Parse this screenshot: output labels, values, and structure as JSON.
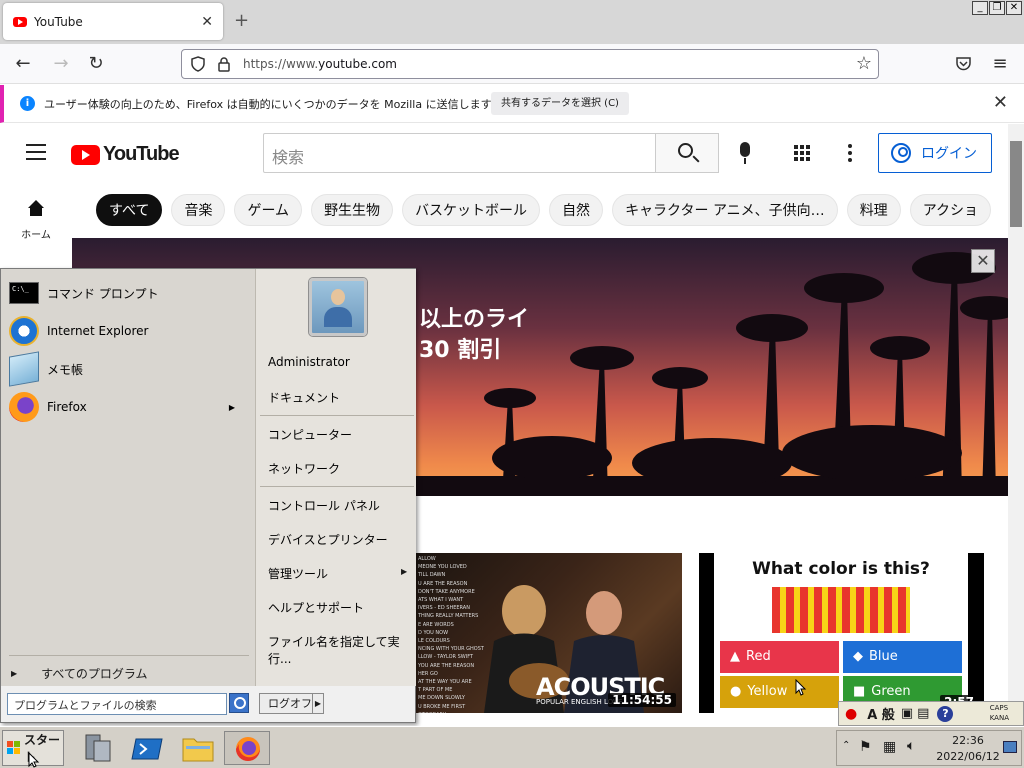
{
  "browser": {
    "tab_title": "YouTube",
    "new_tab": "+",
    "url_prefix": "https://www.",
    "url_domain": "youtube.com",
    "window_min": "_",
    "window_restore": "❐",
    "window_close": "✕"
  },
  "notification": {
    "message": "ユーザー体験の向上のため、Firefox は自動的にいくつかのデータを Mozilla に送信します。",
    "button": "共有するデータを選択 (C)"
  },
  "youtube": {
    "logo_text": "YouTube",
    "search_placeholder": "検索",
    "login_label": "ログイン",
    "home_label": "ホーム",
    "chips": [
      "すべて",
      "音楽",
      "ゲーム",
      "野生生物",
      "バスケットボール",
      "自然",
      "キャラクター アニメ、子供向…",
      "料理",
      "アクショ"
    ],
    "banner_line1": "以上のライ",
    "banner_line2": "30 割引",
    "video1": {
      "title": "ACOUSTIC",
      "subtitle": "POPULAR ENGLISH LOVE",
      "duration": "11:54:55",
      "songs": [
        "ALLOW",
        "MEONE YOU LOVED",
        "TILL DAWN",
        "U ARE THE REASON",
        "DON'T TAKE ANYMORE",
        "ATS WHAT I WANT",
        "IVERS - ED SHEERAN",
        "THING REALLY MATTERS",
        "E ARE WORDS",
        "D YOU NOW",
        "LE COLOURS",
        "NCING WITH YOUR GHOST",
        "LLOW - TAYLOR SWIFT",
        "YOU ARE THE REASON",
        "HER GO",
        "AT THE WAY YOU ARE",
        "T PART OF ME",
        "ME DOWN SLOWLY",
        "U BROKE ME FIRST",
        "OTOGRAPH"
      ]
    },
    "video2": {
      "question": "What color is this?",
      "options": [
        {
          "label": "Red",
          "color": "#e8354a",
          "symbol": "▲"
        },
        {
          "label": "Blue",
          "color": "#1e6fd6",
          "symbol": "◆"
        },
        {
          "label": "Yellow",
          "color": "#d6a20b",
          "symbol": "●"
        },
        {
          "label": "Green",
          "color": "#2f9a32",
          "symbol": "■"
        }
      ],
      "duration": "2:57"
    }
  },
  "start_menu": {
    "left_items": [
      {
        "label": "コマンド プロンプト",
        "icon": "cmd-icon"
      },
      {
        "label": "Internet Explorer",
        "icon": "ie-icon"
      },
      {
        "label": "メモ帳",
        "icon": "notepad-icon"
      },
      {
        "label": "Firefox",
        "icon": "firefox-icon"
      }
    ],
    "all_programs": "すべてのプログラム",
    "search_placeholder": "プログラムとファイルの検索",
    "user": "Administrator",
    "right_items": [
      "ドキュメント",
      "コンピューター",
      "ネットワーク",
      "コントロール パネル",
      "デバイスとプリンター",
      "管理ツール",
      "ヘルプとサポート",
      "ファイル名を指定して実行..."
    ],
    "logoff": "ログオフ",
    "cmd_icon_text": "C:\\_"
  },
  "taskbar": {
    "start_label": "スタート",
    "time": "22:36",
    "date": "2022/06/12",
    "ime_mode": "A 般",
    "caps": "CAPS",
    "kana": "KANA"
  },
  "colors": {
    "yt_red": "#ff0000",
    "yt_blue": "#065fd4",
    "firefox_accent": "#e022b1"
  }
}
